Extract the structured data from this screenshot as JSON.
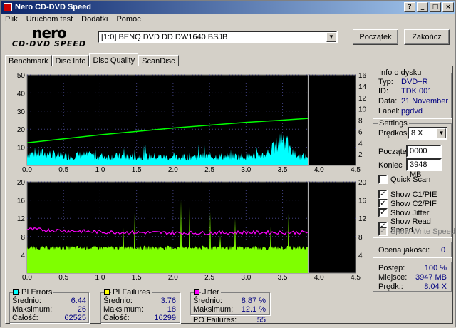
{
  "title": "Nero CD-DVD Speed",
  "title_buttons": [
    "?",
    "_",
    "□",
    "×"
  ],
  "menu": [
    "Plik",
    "Uruchom test",
    "Dodatki",
    "Pomoc"
  ],
  "logo": {
    "line1": "nero",
    "line2": "CD·DVD SPEED"
  },
  "drive": {
    "value": "[1:0]   BENQ DVD DD DW1640 BSJB"
  },
  "buttons": {
    "start": "Początek",
    "exit": "Zakończ"
  },
  "tabs": [
    "Benchmark",
    "Disc Info",
    "Disc Quality",
    "ScanDisc"
  ],
  "active_tab": "Disc Quality",
  "chart_data": [
    {
      "type": "area",
      "name": "upper",
      "x_ticks": [
        "0.0",
        "0.5",
        "1.0",
        "1.5",
        "2.0",
        "2.5",
        "3.0",
        "3.5",
        "4.0",
        "4.5"
      ],
      "y_left_ticks": [
        "50",
        "40",
        "30",
        "20",
        "10"
      ],
      "y_right_ticks": [
        "16",
        "14",
        "12",
        "10",
        "8",
        "6",
        "4",
        "2"
      ],
      "xlim": [
        0,
        4.5
      ],
      "ylim": [
        0,
        50
      ],
      "y2lim": [
        0,
        16
      ],
      "end_marker": 3.85,
      "series": [
        {
          "name": "PI Errors",
          "color": "#00ffff",
          "x": [
            0,
            0.25,
            0.5,
            0.75,
            1.0,
            1.25,
            1.5,
            1.75,
            2.0,
            2.25,
            2.5,
            2.75,
            3.0,
            3.25,
            3.4,
            3.5,
            3.6,
            3.7,
            3.85
          ],
          "values": [
            8,
            8,
            6,
            7,
            6,
            6,
            6,
            6,
            5,
            6,
            6,
            6,
            6,
            7,
            12,
            20,
            10,
            6,
            6
          ]
        },
        {
          "name": "Read Speed",
          "color": "#00ff00",
          "x": [
            0,
            0.5,
            1.0,
            1.5,
            2.0,
            2.5,
            3.0,
            3.5,
            3.85
          ],
          "values": [
            4.0,
            4.7,
            5.4,
            6.0,
            6.6,
            7.1,
            7.6,
            8.0,
            8.3
          ]
        }
      ]
    },
    {
      "type": "area",
      "name": "lower",
      "x_ticks": [
        "0.0",
        "0.5",
        "1.0",
        "1.5",
        "2.0",
        "2.5",
        "3.0",
        "3.5",
        "4.0",
        "4.5"
      ],
      "y_left_ticks": [
        "20",
        "16",
        "12",
        "8",
        "4"
      ],
      "y_right_ticks": [
        "20",
        "16",
        "12",
        "8",
        "4"
      ],
      "xlim": [
        0,
        4.5
      ],
      "ylim": [
        0,
        20
      ],
      "end_marker": 3.85,
      "series": [
        {
          "name": "PI Failures",
          "color": "#7fff00",
          "x": [
            0,
            0.5,
            1.0,
            1.5,
            2.0,
            2.5,
            3.0,
            3.5,
            3.85
          ],
          "values": [
            6,
            6,
            6,
            6,
            6,
            6,
            6,
            6,
            6
          ]
        },
        {
          "name": "Jitter",
          "color": "#ff00ff",
          "x": [
            0,
            0.5,
            1.0,
            1.5,
            2.0,
            2.5,
            3.0,
            3.5,
            3.85
          ],
          "values": [
            9.6,
            9.3,
            9.0,
            8.9,
            8.8,
            8.8,
            8.9,
            8.9,
            8.9
          ]
        }
      ]
    }
  ],
  "info": {
    "title": "Info o dysku",
    "rows": [
      {
        "label": "Typ:",
        "value": "DVD+R"
      },
      {
        "label": "ID:",
        "value": "TDK 001"
      },
      {
        "label": "Data:",
        "value": "21 November"
      },
      {
        "label": "Label:",
        "value": "pgdvd"
      }
    ]
  },
  "settings": {
    "title": "Settings",
    "speed_label": "Prędkość",
    "speed_value": "8 X",
    "start_label": "Początek",
    "start_value": "0000 MB",
    "end_label": "Koniec",
    "end_value": "3948 MB",
    "checkboxes": [
      {
        "label": "Quick Scan",
        "checked": false,
        "disabled": false
      },
      {
        "label": "Show C1/PIE",
        "checked": true,
        "disabled": false
      },
      {
        "label": "Show C2/PIF",
        "checked": true,
        "disabled": false
      },
      {
        "label": "Show Jitter",
        "checked": true,
        "disabled": false
      },
      {
        "label": "Show Read Speed",
        "checked": true,
        "disabled": false
      },
      {
        "label": "Show Write Speed",
        "checked": true,
        "disabled": true
      }
    ]
  },
  "quality": {
    "label": "Ocena jakości:",
    "value": "0"
  },
  "progress": {
    "rows": [
      {
        "label": "Postęp:",
        "value": "100 %"
      },
      {
        "label": "Miejsce:",
        "value": "3947 MB"
      },
      {
        "label": "Prędk.:",
        "value": "8.04 X"
      }
    ]
  },
  "stats": {
    "pi_errors": {
      "title": "PI Errors",
      "color": "#00ffff",
      "rows": [
        {
          "label": "Średnio:",
          "value": "6.44"
        },
        {
          "label": "Maksimum:",
          "value": "26"
        },
        {
          "label": "Całość:",
          "value": "62525"
        }
      ]
    },
    "pi_failures": {
      "title": "PI Failures",
      "color": "#ffff00",
      "rows": [
        {
          "label": "Średnio:",
          "value": "3.76"
        },
        {
          "label": "Maksimum:",
          "value": "18"
        },
        {
          "label": "Całość:",
          "value": "16299"
        }
      ]
    },
    "jitter": {
      "title": "Jitter",
      "color": "#ff00ff",
      "rows": [
        {
          "label": "Średnio:",
          "value": "8.87 %"
        },
        {
          "label": "Maksimum:",
          "value": "12.1 %"
        }
      ]
    },
    "po_failures": {
      "label": "PO Failures:",
      "value": "55"
    }
  }
}
